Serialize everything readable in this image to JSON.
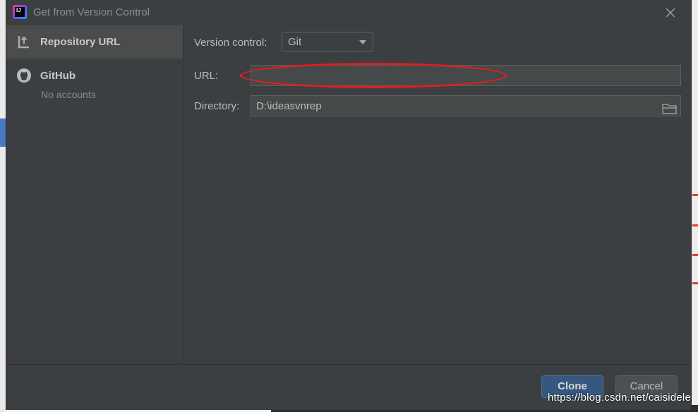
{
  "window": {
    "title": "Get from Version Control"
  },
  "sidebar": {
    "items": [
      {
        "label": "Repository URL",
        "icon": "vcs-branch-icon",
        "selected": true
      },
      {
        "label": "GitHub",
        "sublabel": "No accounts",
        "icon": "github-icon",
        "selected": false
      }
    ]
  },
  "form": {
    "version_control": {
      "label": "Version control:",
      "value": "Git"
    },
    "url": {
      "label": "URL:",
      "value": ""
    },
    "directory": {
      "label": "Directory:",
      "value": "D:\\ideasvnrep"
    }
  },
  "footer": {
    "clone_label": "Clone",
    "cancel_label": "Cancel"
  },
  "watermark": "https://blog.csdn.net/caisidele",
  "colors": {
    "dialog_bg": "#3c3f41",
    "selected_bg": "#4b4d4d",
    "primary_button": "#365880",
    "annotation": "#e01e1e"
  }
}
